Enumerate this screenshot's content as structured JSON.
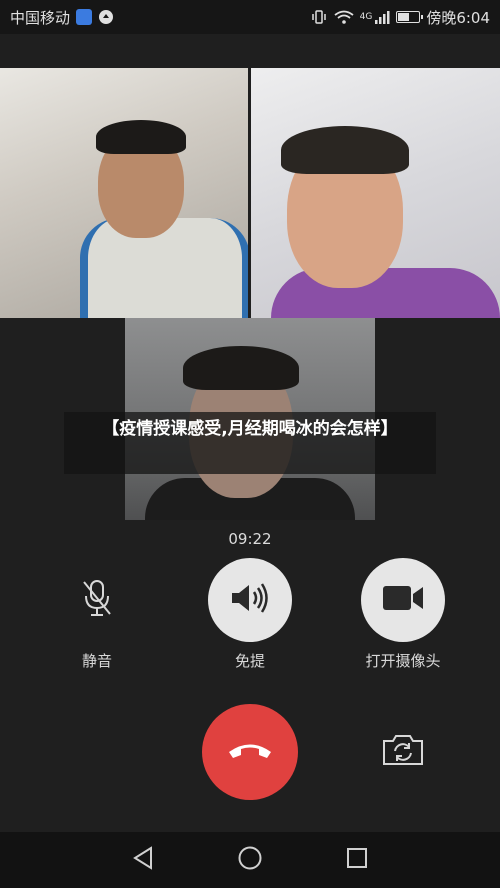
{
  "status_bar": {
    "carrier": "中国移动",
    "time": "傍晚6:04",
    "signal_label": "4G"
  },
  "call": {
    "banner_title": "【疫情授课感受,月经期喝冰的会怎样】",
    "timer": "09:22"
  },
  "controls": {
    "mute_label": "静音",
    "speaker_label": "免提",
    "camera_label": "打开摄像头"
  },
  "colors": {
    "hangup": "#e0413f",
    "background": "#1f1f1f",
    "control_light": "#e6e6e6"
  },
  "icons": {
    "mute": "mic-off-icon",
    "speaker": "speaker-icon",
    "camera": "video-camera-icon",
    "hangup": "phone-hangup-icon",
    "switch": "switch-camera-icon",
    "back": "nav-back-icon",
    "home": "nav-home-icon",
    "recents": "nav-recents-icon"
  }
}
